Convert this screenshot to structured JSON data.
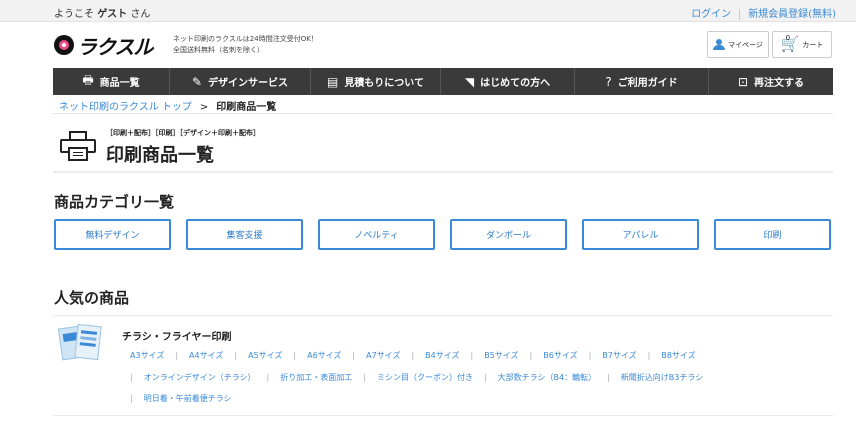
{
  "topbar": {
    "welcome_prefix": "ようこそ",
    "user": "ゲスト",
    "welcome_suffix": "さん",
    "login": "ログイン",
    "register": "新規会員登録(無料)"
  },
  "header": {
    "logo": "ラクスル",
    "tagline_1": "ネット印刷のラクスルは24時間注文受付OK！",
    "tagline_2": "全国送料無料（名刺を除く）",
    "mypage": "マイページ",
    "cart": "カート",
    "cart_count": "0"
  },
  "nav": [
    {
      "icon": "printer-icon",
      "glyph": "🖶",
      "label": "商品一覧"
    },
    {
      "icon": "pen-icon",
      "glyph": "✎",
      "label": "デザインサービス"
    },
    {
      "icon": "document-icon",
      "glyph": "▤",
      "label": "見積もりについて"
    },
    {
      "icon": "beginner-icon",
      "glyph": "◥",
      "label": "はじめての方へ"
    },
    {
      "icon": "question-icon",
      "glyph": "?",
      "label": "ご利用ガイド"
    },
    {
      "icon": "reorder-icon",
      "glyph": "⊡",
      "label": "再注文する"
    }
  ],
  "breadcrumb": {
    "home": "ネット印刷のラクスル トップ",
    "separator": ">",
    "current": "印刷商品一覧"
  },
  "page": {
    "subtitle": "［印刷＋配布］［印刷］［デザイン＋印刷＋配布］",
    "title": "印刷商品一覧"
  },
  "categories": {
    "heading": "商品カテゴリ一覧",
    "items": [
      "無料デザイン",
      "集客支援",
      "ノベルティ",
      "ダンボール",
      "アパレル",
      "印刷"
    ]
  },
  "popular": {
    "heading": "人気の商品",
    "product": {
      "name": "チラシ・フライヤー印刷",
      "row1": [
        "A3サイズ",
        "A4サイズ",
        "A5サイズ",
        "A6サイズ",
        "A7サイズ",
        "B4サイズ",
        "B5サイズ",
        "B6サイズ",
        "B7サイズ",
        "B8サイズ"
      ],
      "row2": [
        "オンラインデザイン（チラシ）",
        "折り加工・表面加工",
        "ミシン目（クーポン）付き",
        "大部数チラシ（B4：輪転）",
        "新聞折込向けB3チラシ"
      ],
      "row3": [
        "明日着・午前着便チラシ"
      ]
    }
  }
}
